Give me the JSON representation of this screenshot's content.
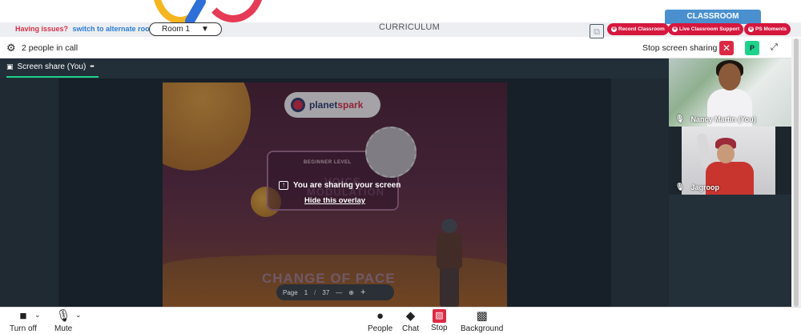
{
  "top": {
    "issue_text": "Having issues?",
    "issue_link": "switch to alternate room",
    "room_label": "Room 1",
    "room_caret": "▼",
    "curriculum": "CURRICULUM",
    "classroom_tab": "CLASSROOM",
    "pills": [
      {
        "label": "Record Classroom",
        "icon": "⊕"
      },
      {
        "label": "Live Classroom Support",
        "icon": "⊕"
      },
      {
        "label": "PS Moments",
        "icon": "⊕"
      }
    ]
  },
  "call": {
    "people_count": "2 people in call",
    "stop_sharing": "Stop screen sharing",
    "close_glyph": "✕",
    "avatar_initial": "P",
    "fullscreen_glyph": "⤢",
    "gear_glyph": "⚙"
  },
  "share": {
    "tab_label": "Screen share (You)",
    "tab_more": "•••",
    "overlay_message": "You are sharing your screen",
    "overlay_hide": "Hide this overlay",
    "popout_glyph": "⧉",
    "pager": {
      "page_label": "Page",
      "page": "1",
      "sep": "/",
      "total": "37",
      "zoom_out": "—",
      "zoom_icon": "⊕",
      "zoom_in": "+"
    }
  },
  "slide": {
    "logo_plain": "planet",
    "logo_bold": "spark",
    "level": "BEGINNER LEVEL",
    "title_line1": "VOICE",
    "title_line2": "MODULATION",
    "bottom_title": "CHANGE OF PACE"
  },
  "participants": [
    {
      "name": "Nancy Martin (You)",
      "mic": "🎤"
    },
    {
      "name": "Jagroop",
      "mic": "🎤"
    }
  ],
  "toolbar": {
    "turn_off": "Turn off",
    "mute": "Mute",
    "people": "People",
    "chat": "Chat",
    "stop": "Stop",
    "background": "Background",
    "caret": "⌄"
  },
  "colors": {
    "accent_red": "#dc2a45",
    "accent_green": "#1fd18a",
    "link_blue": "#2c7bd4",
    "classroom_blue": "#4a90cf"
  }
}
